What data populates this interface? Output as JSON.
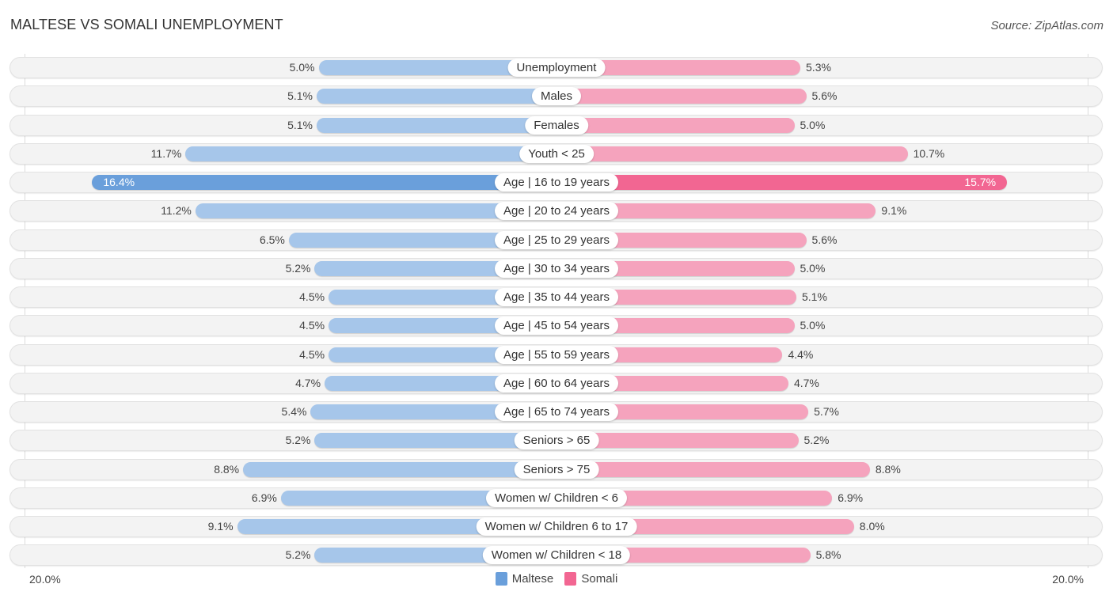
{
  "header": {
    "title": "MALTESE VS SOMALI UNEMPLOYMENT",
    "source": "Source: ZipAtlas.com"
  },
  "chart_data": {
    "type": "bar",
    "orientation": "horizontal-diverging",
    "title": "MALTESE VS SOMALI UNEMPLOYMENT",
    "categories": [
      "Unemployment",
      "Males",
      "Females",
      "Youth < 25",
      "Age | 16 to 19 years",
      "Age | 20 to 24 years",
      "Age | 25 to 29 years",
      "Age | 30 to 34 years",
      "Age | 35 to 44 years",
      "Age | 45 to 54 years",
      "Age | 55 to 59 years",
      "Age | 60 to 64 years",
      "Age | 65 to 74 years",
      "Seniors > 65",
      "Seniors > 75",
      "Women w/ Children < 6",
      "Women w/ Children 6 to 17",
      "Women w/ Children < 18"
    ],
    "series": [
      {
        "name": "Maltese",
        "color": "#6a9fdb",
        "values": [
          5.0,
          5.1,
          5.1,
          11.7,
          16.4,
          11.2,
          6.5,
          5.2,
          4.5,
          4.5,
          4.5,
          4.7,
          5.4,
          5.2,
          8.8,
          6.9,
          9.1,
          5.2
        ],
        "labels": [
          "5.0%",
          "5.1%",
          "5.1%",
          "11.7%",
          "16.4%",
          "11.2%",
          "6.5%",
          "5.2%",
          "4.5%",
          "4.5%",
          "4.5%",
          "4.7%",
          "5.4%",
          "5.2%",
          "8.8%",
          "6.9%",
          "9.1%",
          "5.2%"
        ]
      },
      {
        "name": "Somali",
        "color": "#f26692",
        "values": [
          5.3,
          5.6,
          5.0,
          10.7,
          15.7,
          9.1,
          5.6,
          5.0,
          5.1,
          5.0,
          4.4,
          4.7,
          5.7,
          5.2,
          8.8,
          6.9,
          8.0,
          5.8
        ],
        "labels": [
          "5.3%",
          "5.6%",
          "5.0%",
          "10.7%",
          "15.7%",
          "9.1%",
          "5.6%",
          "5.0%",
          "5.1%",
          "5.0%",
          "4.4%",
          "4.7%",
          "5.7%",
          "5.2%",
          "8.8%",
          "6.9%",
          "8.0%",
          "5.8%"
        ]
      }
    ],
    "highlight_index": 4,
    "axis": {
      "left_label": "20.0%",
      "right_label": "20.0%",
      "max": 20.0
    },
    "legend": {
      "position": "bottom-center",
      "items": [
        "Maltese",
        "Somali"
      ]
    },
    "unit": "%"
  }
}
